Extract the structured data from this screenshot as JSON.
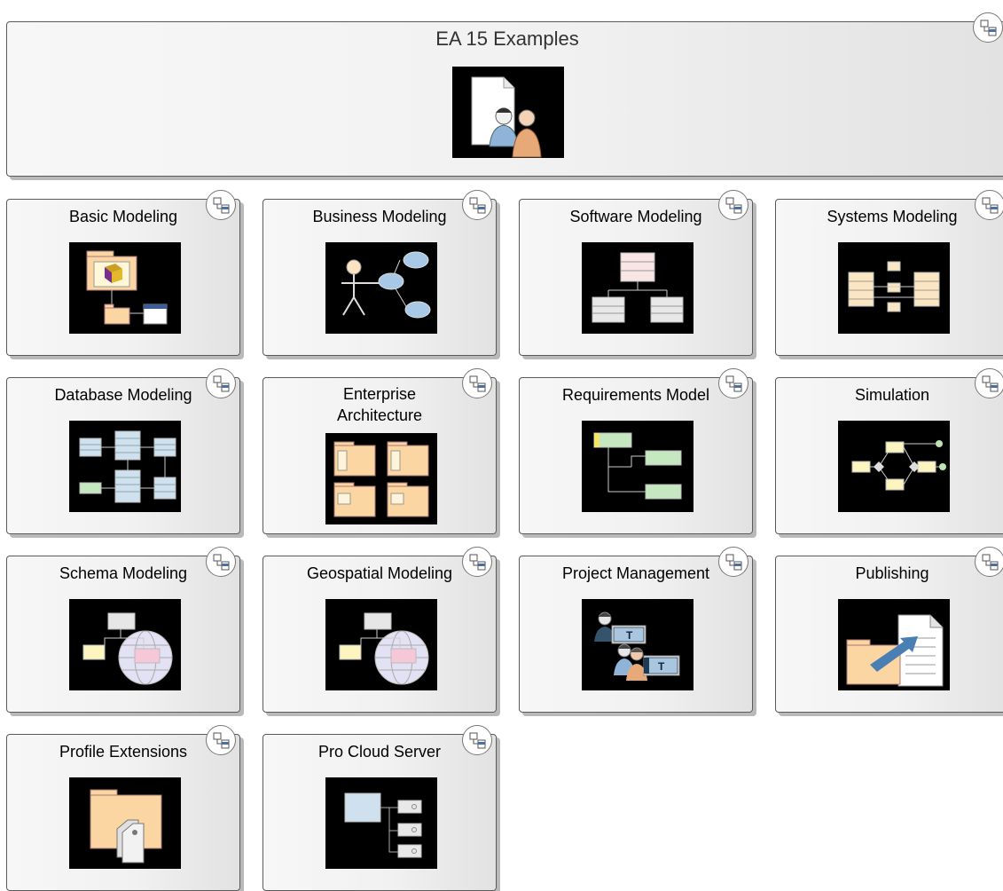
{
  "header": {
    "title": "EA 15 Examples",
    "icon": "users-document-icon"
  },
  "tiles": [
    {
      "title": "Basic Modeling",
      "icon": "package-cube-icon"
    },
    {
      "title": "Business Modeling",
      "icon": "actor-usecase-icon"
    },
    {
      "title": "Software Modeling",
      "icon": "class-hierarchy-icon"
    },
    {
      "title": "Systems Modeling",
      "icon": "block-ports-icon"
    },
    {
      "title": "Database Modeling",
      "icon": "database-tables-icon"
    },
    {
      "title": "Enterprise Architecture",
      "icon": "architecture-packages-icon"
    },
    {
      "title": "Requirements Model",
      "icon": "requirements-tree-icon"
    },
    {
      "title": "Simulation",
      "icon": "simulation-flow-icon"
    },
    {
      "title": "Schema Modeling",
      "icon": "schema-globe-icon"
    },
    {
      "title": "Geospatial Modeling",
      "icon": "geospatial-globe-icon"
    },
    {
      "title": "Project Management",
      "icon": "team-tasks-icon"
    },
    {
      "title": "Publishing",
      "icon": "publish-document-icon"
    },
    {
      "title": "Profile Extensions",
      "icon": "profile-tag-icon"
    },
    {
      "title": "Pro Cloud Server",
      "icon": "cloud-server-icon"
    }
  ],
  "navigate_icon": "navigate-diagram-icon",
  "colors": {
    "thumb_background": "#000000",
    "class_fill": "#f9e5e5",
    "table_fill": "#cfe0ef",
    "requirement_fill": "#c6e8c0",
    "folder_fill": "#fbd6a3",
    "note_fill": "#fdf5c0"
  }
}
